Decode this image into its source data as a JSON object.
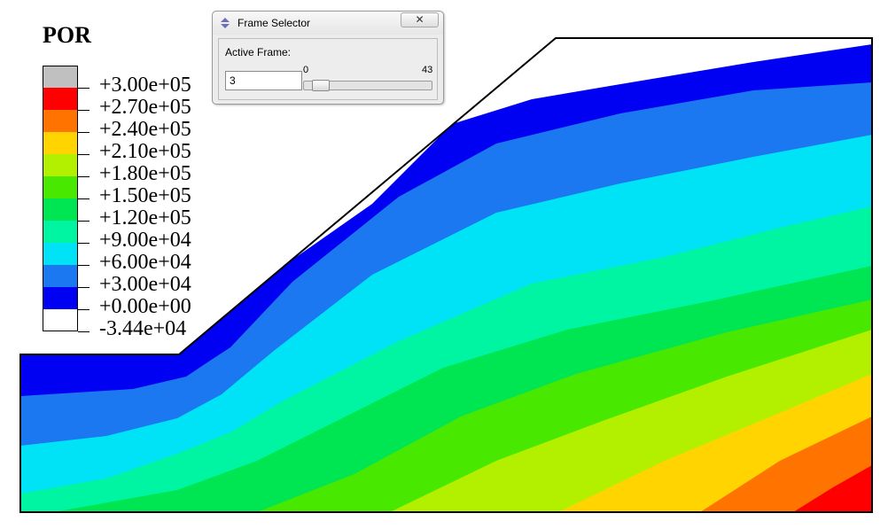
{
  "legend": {
    "title": "POR",
    "entries": [
      {
        "label": "+3.00e+05",
        "color": "#c0c0c0"
      },
      {
        "label": "+2.70e+05",
        "color": "#ff0000"
      },
      {
        "label": "+2.40e+05",
        "color": "#ff7300"
      },
      {
        "label": "+2.10e+05",
        "color": "#ffd400"
      },
      {
        "label": "+1.80e+05",
        "color": "#b3f000"
      },
      {
        "label": "+1.50e+05",
        "color": "#48e800"
      },
      {
        "label": "+1.20e+05",
        "color": "#00e652"
      },
      {
        "label": "+9.00e+04",
        "color": "#00f5a2"
      },
      {
        "label": "+6.00e+04",
        "color": "#00e2f5"
      },
      {
        "label": "+3.00e+04",
        "color": "#1c78f0"
      },
      {
        "label": "+0.00e+00",
        "color": "#0000f2"
      },
      {
        "label": "-3.44e+04",
        "color": "#ffffff"
      }
    ]
  },
  "contour_colors": [
    "#0000f2",
    "#1c78f0",
    "#00e2f5",
    "#00f5a2",
    "#00e652",
    "#48e800",
    "#b3f000",
    "#ffd400",
    "#ff7300",
    "#ff0000"
  ],
  "dialog": {
    "title": "Frame Selector",
    "close_label": "✕",
    "active_frame_label": "Active Frame:",
    "frame_value": "3",
    "slider_min": "0",
    "slider_max": "43",
    "slider_fraction": 0.0698
  }
}
